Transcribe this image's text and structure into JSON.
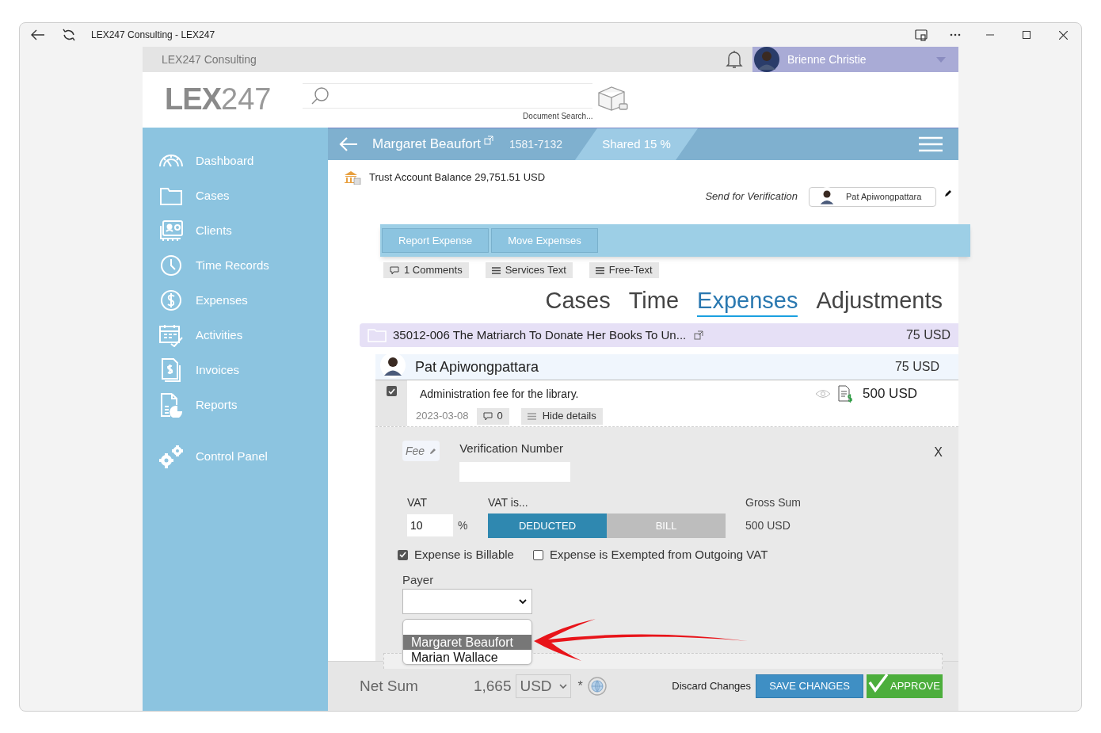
{
  "window": {
    "title": "LEX247 Consulting - LEX247"
  },
  "top_bar": {
    "org_name": "LEX247 Consulting",
    "user_name": "Brienne Christie"
  },
  "header": {
    "logo_bold": "LEX",
    "logo_light": "247",
    "search_caption": "Document Search..."
  },
  "sidebar": {
    "items": [
      {
        "label": "Dashboard"
      },
      {
        "label": "Cases"
      },
      {
        "label": "Clients"
      },
      {
        "label": "Time Records"
      },
      {
        "label": "Expenses"
      },
      {
        "label": "Activities"
      },
      {
        "label": "Invoices"
      },
      {
        "label": "Reports"
      },
      {
        "label": "Control Panel"
      }
    ]
  },
  "matter": {
    "client": "Margaret Beaufort",
    "number": "1581-7132",
    "shared": "Shared 15 %"
  },
  "trust_balance": "Trust Account Balance 29,751.51 USD",
  "verification": {
    "label": "Send for Verification",
    "person": "Pat Apiwongpattara"
  },
  "actions": [
    "Report Expense",
    "Move Expenses"
  ],
  "subtabs": [
    {
      "kind": "comment",
      "label": "1 Comments"
    },
    {
      "kind": "list",
      "label": "Services Text"
    },
    {
      "kind": "list",
      "label": "Free-Text"
    }
  ],
  "views": [
    {
      "label": "Cases",
      "selected": false
    },
    {
      "label": "Time",
      "selected": false
    },
    {
      "label": "Expenses",
      "selected": true
    },
    {
      "label": "Adjustments",
      "selected": false
    }
  ],
  "case_row": {
    "title": "35012-006 The Matriarch To Donate Her Books To Un...",
    "amount": "75 USD"
  },
  "person_row": {
    "name": "Pat Apiwongpattara",
    "amount": "75 USD"
  },
  "expense": {
    "checked": true,
    "description": "Administration fee for the library.",
    "amount": "500 USD",
    "date": "2023-03-08",
    "comments": "0",
    "details_button": "Hide details"
  },
  "details": {
    "type": "Fee",
    "verification_label": "Verification Number",
    "close": "X",
    "vat_label": "VAT",
    "vat_value": "10",
    "vat_unit": "%",
    "vat_mode_label": "VAT is...",
    "vat_modes": [
      {
        "label": "DEDUCTED",
        "selected": true
      },
      {
        "label": "BILL",
        "selected": false
      }
    ],
    "gross_label": "Gross Sum",
    "gross_value": "500 USD",
    "checkboxes": [
      {
        "label": "Expense is Billable",
        "checked": true
      },
      {
        "label": "Expense is Exempted from Outgoing VAT",
        "checked": false
      }
    ],
    "payer_label": "Payer",
    "payer_options": [
      {
        "label": "Margaret Beaufort",
        "selected": true
      },
      {
        "label": "Marian Wallace",
        "selected": false
      }
    ]
  },
  "footer": {
    "net_label": "Net Sum",
    "net_value": "1,665",
    "currency": "USD",
    "asterisk": "*",
    "discard": "Discard Changes",
    "save": "SAVE CHANGES",
    "approve": "APPROVE"
  }
}
